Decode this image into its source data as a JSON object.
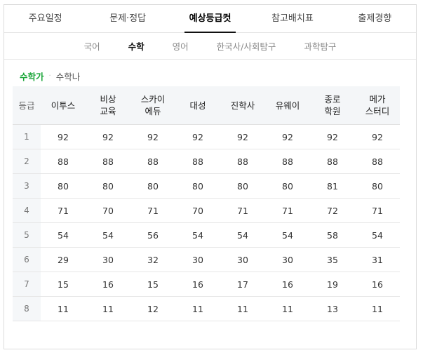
{
  "tabs": [
    {
      "label": "주요일정",
      "active": false
    },
    {
      "label": "문제·정답",
      "active": false
    },
    {
      "label": "예상등급컷",
      "active": true
    },
    {
      "label": "참고배치표",
      "active": false
    },
    {
      "label": "출제경향",
      "active": false
    }
  ],
  "subtabs": [
    {
      "label": "국어",
      "active": false
    },
    {
      "label": "수학",
      "active": true
    },
    {
      "label": "영어",
      "active": false
    },
    {
      "label": "한국사/사회탐구",
      "active": false
    },
    {
      "label": "과학탐구",
      "active": false
    }
  ],
  "variant": {
    "active": "수학가",
    "separator": "·",
    "other": "수학나"
  },
  "table": {
    "grade_header": "등급",
    "columns": [
      [
        "이투스"
      ],
      [
        "비상",
        "교육"
      ],
      [
        "스카이",
        "에듀"
      ],
      [
        "대성"
      ],
      [
        "진학사"
      ],
      [
        "유웨이"
      ],
      [
        "종로",
        "학원"
      ],
      [
        "메가",
        "스터디"
      ]
    ],
    "rows": [
      {
        "grade": "1",
        "values": [
          "92",
          "92",
          "92",
          "92",
          "92",
          "92",
          "92",
          "92"
        ]
      },
      {
        "grade": "2",
        "values": [
          "88",
          "88",
          "88",
          "88",
          "88",
          "88",
          "88",
          "88"
        ]
      },
      {
        "grade": "3",
        "values": [
          "80",
          "80",
          "80",
          "80",
          "80",
          "80",
          "81",
          "80"
        ]
      },
      {
        "grade": "4",
        "values": [
          "71",
          "70",
          "71",
          "70",
          "71",
          "71",
          "72",
          "71"
        ]
      },
      {
        "grade": "5",
        "values": [
          "54",
          "54",
          "56",
          "54",
          "54",
          "54",
          "58",
          "54"
        ]
      },
      {
        "grade": "6",
        "values": [
          "29",
          "30",
          "32",
          "30",
          "30",
          "30",
          "35",
          "31"
        ]
      },
      {
        "grade": "7",
        "values": [
          "15",
          "16",
          "15",
          "16",
          "17",
          "16",
          "19",
          "16"
        ]
      },
      {
        "grade": "8",
        "values": [
          "11",
          "11",
          "12",
          "11",
          "11",
          "11",
          "13",
          "11"
        ]
      }
    ]
  },
  "colors": {
    "accent": "#19a538",
    "header_bg": "#f4f6f8",
    "border": "#dcdcdc"
  }
}
